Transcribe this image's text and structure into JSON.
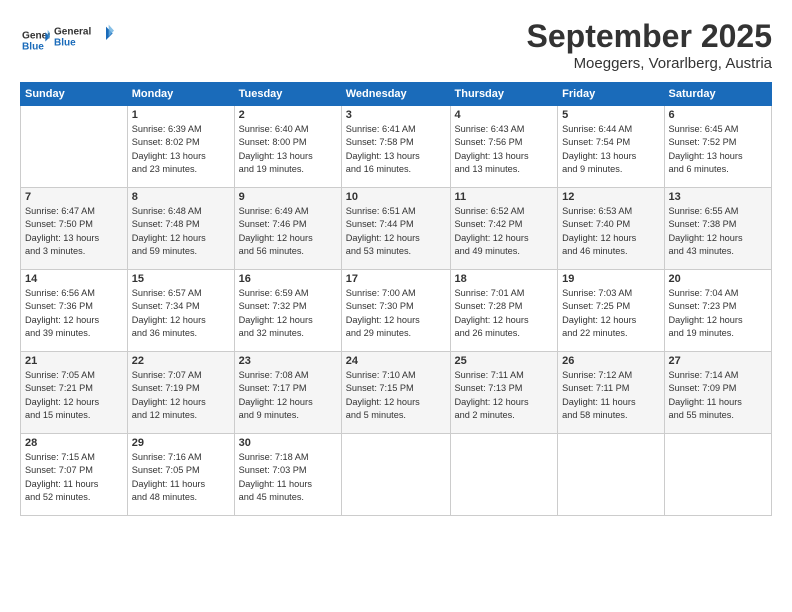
{
  "logo": {
    "line1": "General",
    "line2": "Blue"
  },
  "title": "September 2025",
  "subtitle": "Moeggers, Vorarlberg, Austria",
  "header_days": [
    "Sunday",
    "Monday",
    "Tuesday",
    "Wednesday",
    "Thursday",
    "Friday",
    "Saturday"
  ],
  "weeks": [
    [
      {
        "day": "",
        "lines": []
      },
      {
        "day": "1",
        "lines": [
          "Sunrise: 6:39 AM",
          "Sunset: 8:02 PM",
          "Daylight: 13 hours",
          "and 23 minutes."
        ]
      },
      {
        "day": "2",
        "lines": [
          "Sunrise: 6:40 AM",
          "Sunset: 8:00 PM",
          "Daylight: 13 hours",
          "and 19 minutes."
        ]
      },
      {
        "day": "3",
        "lines": [
          "Sunrise: 6:41 AM",
          "Sunset: 7:58 PM",
          "Daylight: 13 hours",
          "and 16 minutes."
        ]
      },
      {
        "day": "4",
        "lines": [
          "Sunrise: 6:43 AM",
          "Sunset: 7:56 PM",
          "Daylight: 13 hours",
          "and 13 minutes."
        ]
      },
      {
        "day": "5",
        "lines": [
          "Sunrise: 6:44 AM",
          "Sunset: 7:54 PM",
          "Daylight: 13 hours",
          "and 9 minutes."
        ]
      },
      {
        "day": "6",
        "lines": [
          "Sunrise: 6:45 AM",
          "Sunset: 7:52 PM",
          "Daylight: 13 hours",
          "and 6 minutes."
        ]
      }
    ],
    [
      {
        "day": "7",
        "lines": [
          "Sunrise: 6:47 AM",
          "Sunset: 7:50 PM",
          "Daylight: 13 hours",
          "and 3 minutes."
        ]
      },
      {
        "day": "8",
        "lines": [
          "Sunrise: 6:48 AM",
          "Sunset: 7:48 PM",
          "Daylight: 12 hours",
          "and 59 minutes."
        ]
      },
      {
        "day": "9",
        "lines": [
          "Sunrise: 6:49 AM",
          "Sunset: 7:46 PM",
          "Daylight: 12 hours",
          "and 56 minutes."
        ]
      },
      {
        "day": "10",
        "lines": [
          "Sunrise: 6:51 AM",
          "Sunset: 7:44 PM",
          "Daylight: 12 hours",
          "and 53 minutes."
        ]
      },
      {
        "day": "11",
        "lines": [
          "Sunrise: 6:52 AM",
          "Sunset: 7:42 PM",
          "Daylight: 12 hours",
          "and 49 minutes."
        ]
      },
      {
        "day": "12",
        "lines": [
          "Sunrise: 6:53 AM",
          "Sunset: 7:40 PM",
          "Daylight: 12 hours",
          "and 46 minutes."
        ]
      },
      {
        "day": "13",
        "lines": [
          "Sunrise: 6:55 AM",
          "Sunset: 7:38 PM",
          "Daylight: 12 hours",
          "and 43 minutes."
        ]
      }
    ],
    [
      {
        "day": "14",
        "lines": [
          "Sunrise: 6:56 AM",
          "Sunset: 7:36 PM",
          "Daylight: 12 hours",
          "and 39 minutes."
        ]
      },
      {
        "day": "15",
        "lines": [
          "Sunrise: 6:57 AM",
          "Sunset: 7:34 PM",
          "Daylight: 12 hours",
          "and 36 minutes."
        ]
      },
      {
        "day": "16",
        "lines": [
          "Sunrise: 6:59 AM",
          "Sunset: 7:32 PM",
          "Daylight: 12 hours",
          "and 32 minutes."
        ]
      },
      {
        "day": "17",
        "lines": [
          "Sunrise: 7:00 AM",
          "Sunset: 7:30 PM",
          "Daylight: 12 hours",
          "and 29 minutes."
        ]
      },
      {
        "day": "18",
        "lines": [
          "Sunrise: 7:01 AM",
          "Sunset: 7:28 PM",
          "Daylight: 12 hours",
          "and 26 minutes."
        ]
      },
      {
        "day": "19",
        "lines": [
          "Sunrise: 7:03 AM",
          "Sunset: 7:25 PM",
          "Daylight: 12 hours",
          "and 22 minutes."
        ]
      },
      {
        "day": "20",
        "lines": [
          "Sunrise: 7:04 AM",
          "Sunset: 7:23 PM",
          "Daylight: 12 hours",
          "and 19 minutes."
        ]
      }
    ],
    [
      {
        "day": "21",
        "lines": [
          "Sunrise: 7:05 AM",
          "Sunset: 7:21 PM",
          "Daylight: 12 hours",
          "and 15 minutes."
        ]
      },
      {
        "day": "22",
        "lines": [
          "Sunrise: 7:07 AM",
          "Sunset: 7:19 PM",
          "Daylight: 12 hours",
          "and 12 minutes."
        ]
      },
      {
        "day": "23",
        "lines": [
          "Sunrise: 7:08 AM",
          "Sunset: 7:17 PM",
          "Daylight: 12 hours",
          "and 9 minutes."
        ]
      },
      {
        "day": "24",
        "lines": [
          "Sunrise: 7:10 AM",
          "Sunset: 7:15 PM",
          "Daylight: 12 hours",
          "and 5 minutes."
        ]
      },
      {
        "day": "25",
        "lines": [
          "Sunrise: 7:11 AM",
          "Sunset: 7:13 PM",
          "Daylight: 12 hours",
          "and 2 minutes."
        ]
      },
      {
        "day": "26",
        "lines": [
          "Sunrise: 7:12 AM",
          "Sunset: 7:11 PM",
          "Daylight: 11 hours",
          "and 58 minutes."
        ]
      },
      {
        "day": "27",
        "lines": [
          "Sunrise: 7:14 AM",
          "Sunset: 7:09 PM",
          "Daylight: 11 hours",
          "and 55 minutes."
        ]
      }
    ],
    [
      {
        "day": "28",
        "lines": [
          "Sunrise: 7:15 AM",
          "Sunset: 7:07 PM",
          "Daylight: 11 hours",
          "and 52 minutes."
        ]
      },
      {
        "day": "29",
        "lines": [
          "Sunrise: 7:16 AM",
          "Sunset: 7:05 PM",
          "Daylight: 11 hours",
          "and 48 minutes."
        ]
      },
      {
        "day": "30",
        "lines": [
          "Sunrise: 7:18 AM",
          "Sunset: 7:03 PM",
          "Daylight: 11 hours",
          "and 45 minutes."
        ]
      },
      {
        "day": "",
        "lines": []
      },
      {
        "day": "",
        "lines": []
      },
      {
        "day": "",
        "lines": []
      },
      {
        "day": "",
        "lines": []
      }
    ]
  ]
}
